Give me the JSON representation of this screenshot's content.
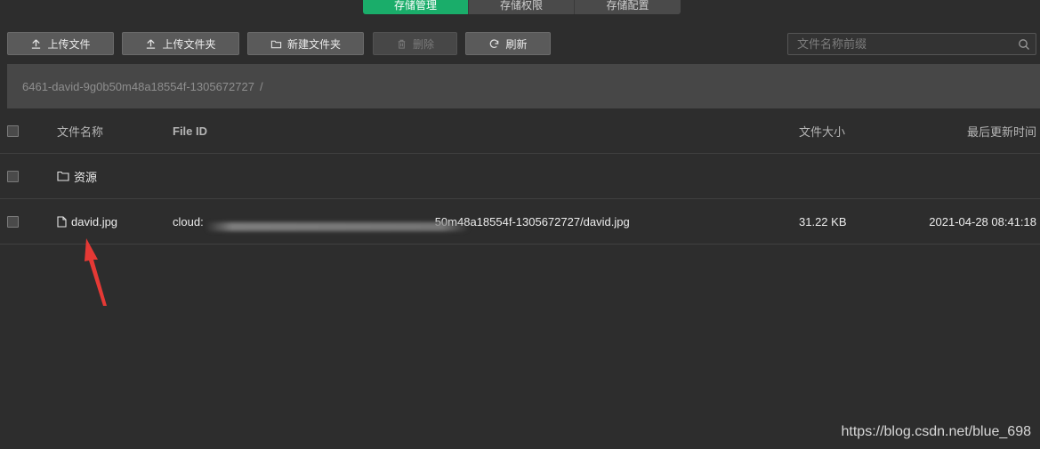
{
  "tabs": [
    {
      "label": "存储管理",
      "active": true
    },
    {
      "label": "存储权限",
      "active": false
    },
    {
      "label": "存储配置",
      "active": false
    }
  ],
  "toolbar": {
    "upload_file": "上传文件",
    "upload_folder": "上传文件夹",
    "new_folder": "新建文件夹",
    "delete": "删除",
    "refresh": "刷新"
  },
  "search": {
    "placeholder": "文件名称前缀",
    "icon": "search-icon"
  },
  "breadcrumb": {
    "path": "6461-david-9g0b50m48a18554f-1305672727",
    "separator": "/"
  },
  "table": {
    "headers": {
      "name": "文件名称",
      "file_id": "File ID",
      "size": "文件大小",
      "updated": "最后更新时间"
    },
    "rows": [
      {
        "type": "folder",
        "name": "资源",
        "file_id": "",
        "size": "",
        "updated": ""
      },
      {
        "type": "file",
        "name": "david.jpg",
        "file_id_prefix": "cloud:",
        "file_id_suffix": "50m48a18554f-1305672727/david.jpg",
        "size": "31.22 KB",
        "updated": "2021-04-28 08:41:18"
      }
    ]
  },
  "watermark": "https://blog.csdn.net/blue_698",
  "colors": {
    "accent": "#1aad6a",
    "background": "#2d2d2d",
    "annotation_arrow": "#e53935"
  }
}
